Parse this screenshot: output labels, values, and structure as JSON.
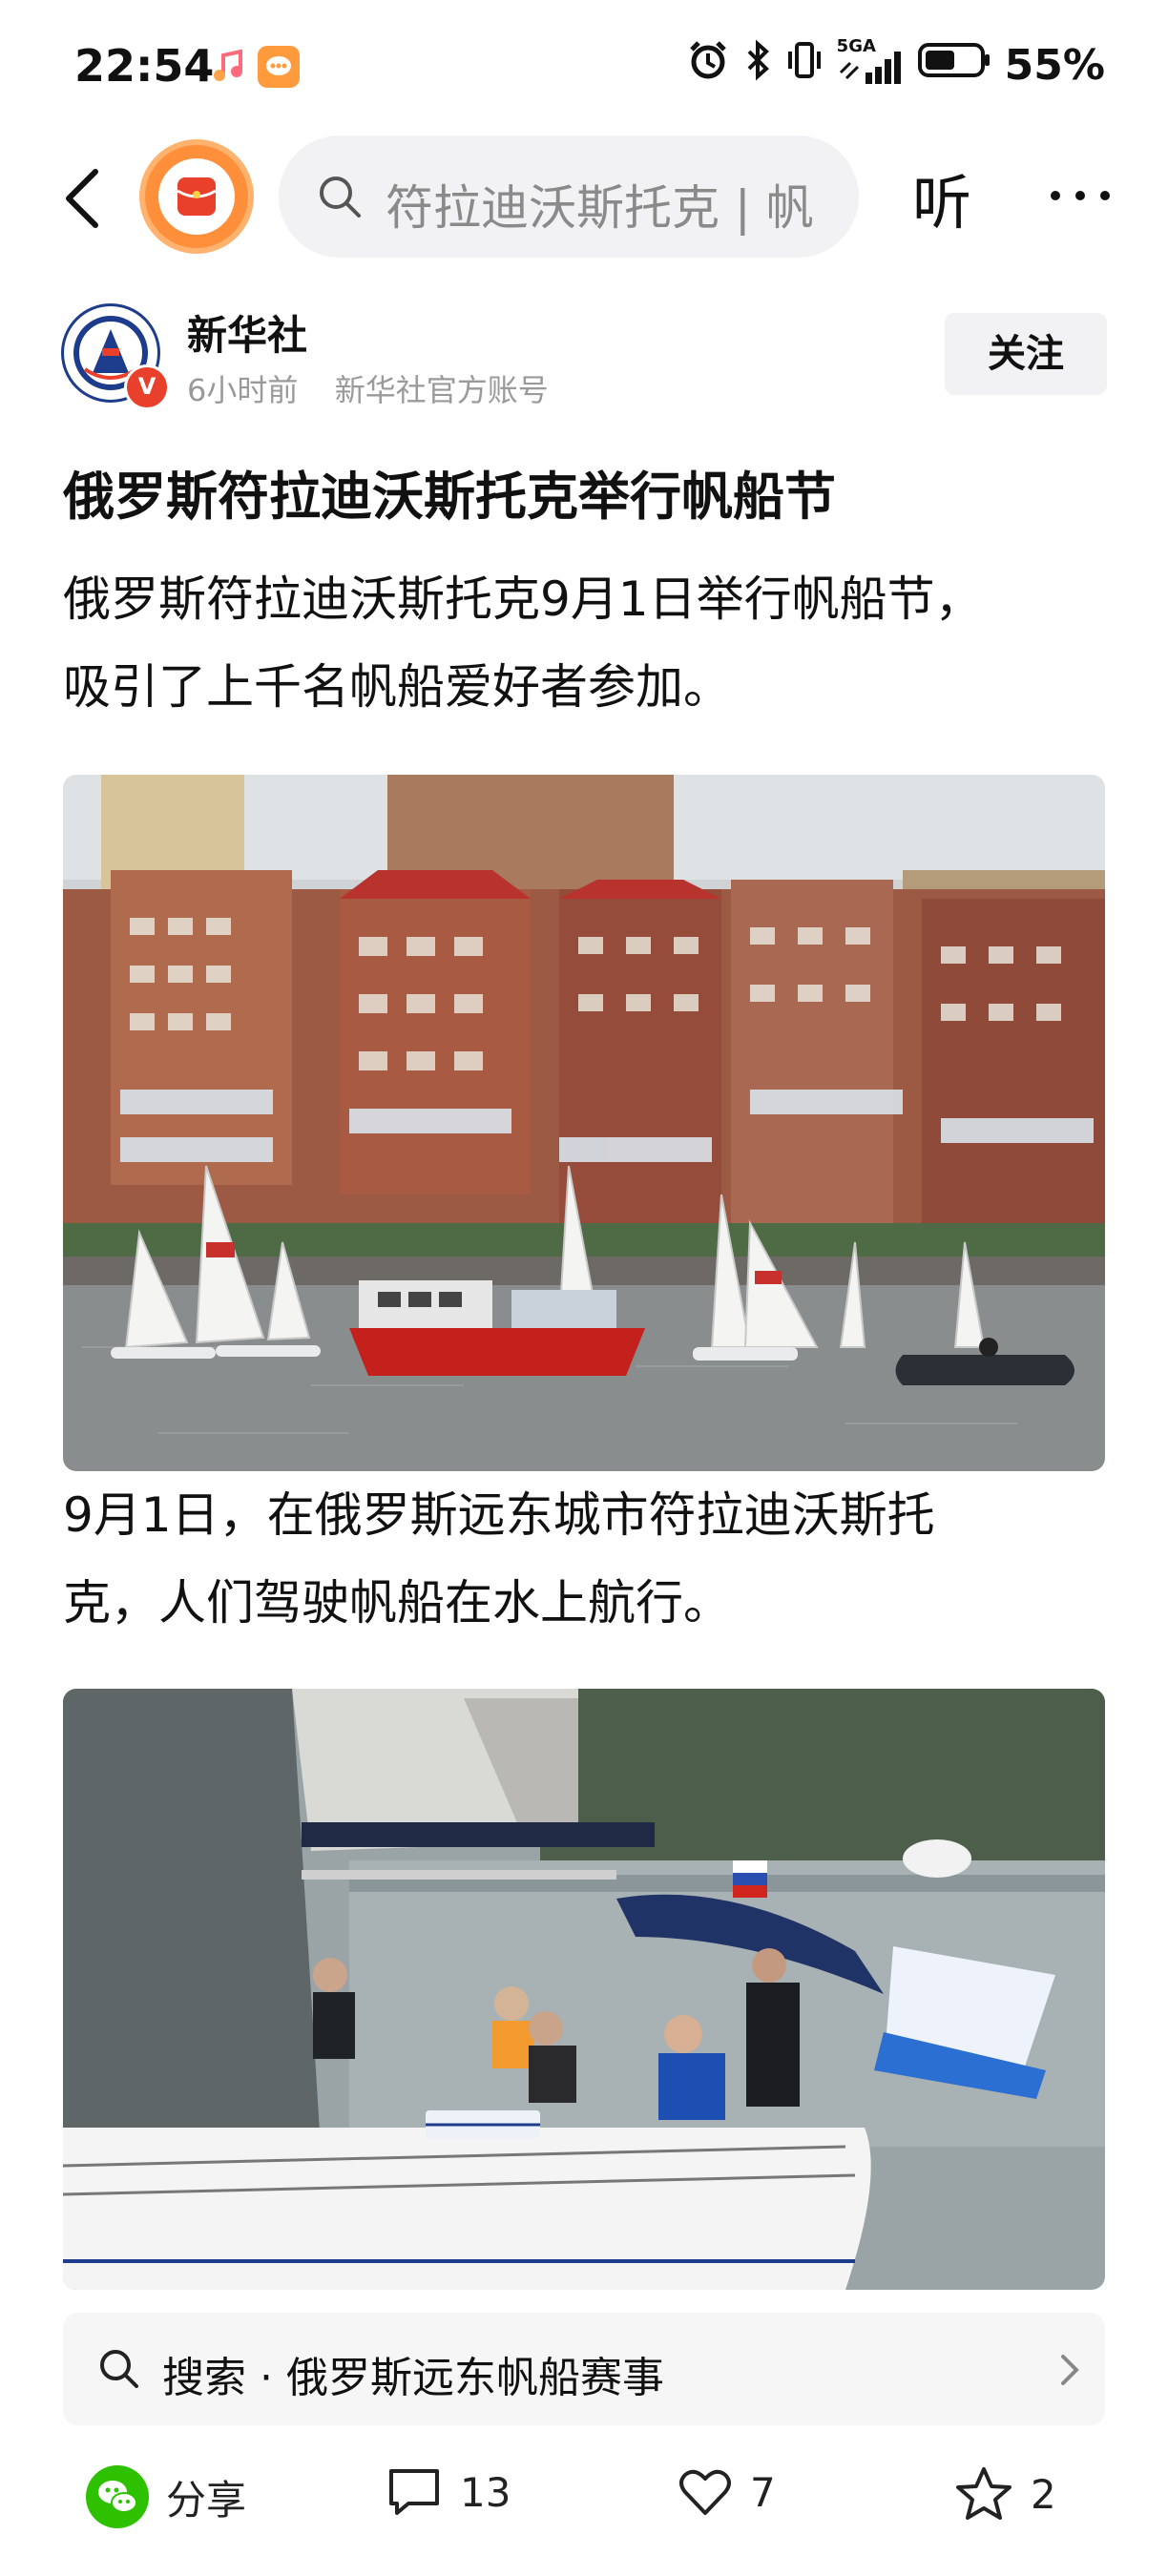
{
  "status_bar": {
    "time": "22:54",
    "signal_label": "5GA",
    "battery_percent": "55%",
    "icons": [
      "music-app-icon",
      "message-app-icon",
      "alarm-icon",
      "bluetooth-icon",
      "vibrate-icon",
      "signal-icon",
      "battery-icon"
    ]
  },
  "top_bar": {
    "search_placeholder": "符拉迪沃斯托克 | 帆",
    "listen_label": "听",
    "icons": [
      "back-icon",
      "app-logo",
      "search-icon",
      "more-icon"
    ]
  },
  "author": {
    "name": "新华社",
    "time_ago": "6小时前",
    "account_type": "新华社官方账号",
    "verified_mark": "V",
    "follow_label": "关注"
  },
  "article": {
    "title": "俄罗斯符拉迪沃斯托克举行帆船节",
    "lead_line_1": "俄罗斯符拉迪沃斯托克9月1日举行帆船节，",
    "lead_line_2": "吸引了上千名帆船爱好者参加。",
    "caption_1_line_1": "9月1日，在俄罗斯远东城市符拉迪沃斯托",
    "caption_1_line_2": "克，人们驾驶帆船在水上航行。"
  },
  "related_search": {
    "text": "搜索 · 俄罗斯远东帆船赛事"
  },
  "bottom_bar": {
    "share_label": "分享",
    "comment_count": "13",
    "like_count": "7",
    "favorite_count": "2"
  },
  "colors": {
    "accent_orange": "#ff8f3a",
    "verified_red": "#e8402b",
    "wechat_green": "#2dc100",
    "water_gray": "#8a8d8e"
  }
}
